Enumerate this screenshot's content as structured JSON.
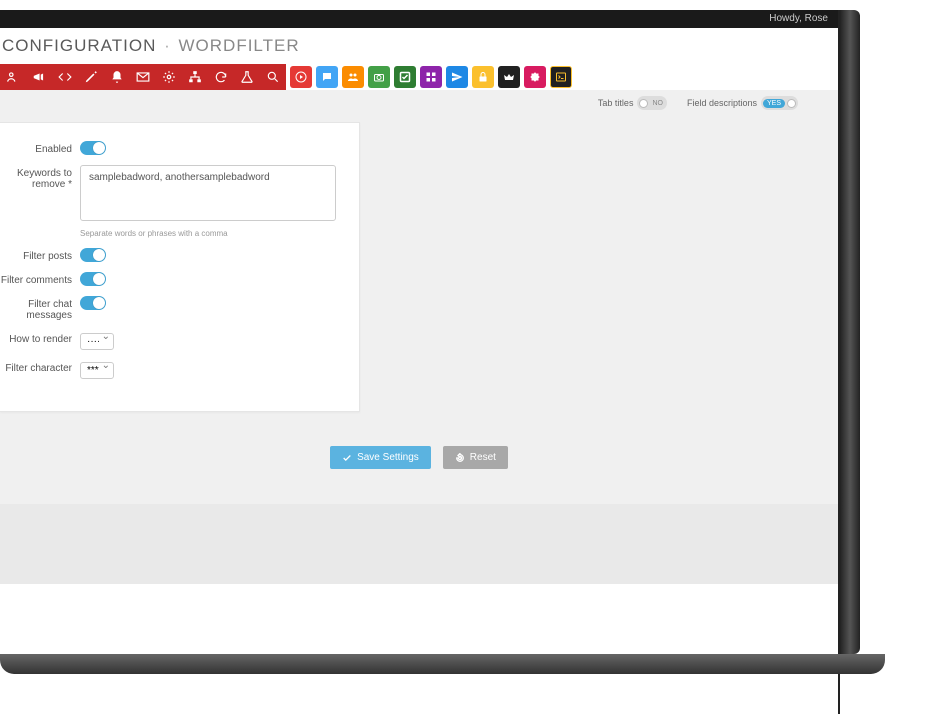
{
  "header": {
    "greeting": "Howdy, Rose",
    "title_main": "CONFIGURATION",
    "title_sub": "WORDFILTER"
  },
  "toolbar": {
    "red_icons": [
      "users",
      "megaphone",
      "code",
      "pencil",
      "bell",
      "mail",
      "gears",
      "sitemap",
      "refresh",
      "flask",
      "search"
    ],
    "color_icons": [
      {
        "name": "play",
        "bg": "#e53935"
      },
      {
        "name": "chat",
        "bg": "#42a5f5"
      },
      {
        "name": "crowd",
        "bg": "#fb8c00"
      },
      {
        "name": "camera",
        "bg": "#43a047"
      },
      {
        "name": "check",
        "bg": "#2e7d32"
      },
      {
        "name": "grid",
        "bg": "#8e24aa"
      },
      {
        "name": "send",
        "bg": "#1e88e5"
      },
      {
        "name": "lock",
        "bg": "#fbc02d"
      },
      {
        "name": "crown",
        "bg": "#212121"
      },
      {
        "name": "puzzle",
        "bg": "#d81b60"
      },
      {
        "name": "terminal",
        "bg": "#212121"
      }
    ]
  },
  "options": {
    "tab_titles_label": "Tab titles",
    "tab_titles_on": "NO",
    "field_desc_label": "Field descriptions",
    "field_desc_on": "YES"
  },
  "form": {
    "enabled_label": "Enabled",
    "keywords_label": "Keywords to remove *",
    "keywords_value": "samplebadword, anothersamplebadword",
    "keywords_hint": "Separate words or phrases with a comma",
    "filter_posts_label": "Filter posts",
    "filter_comments_label": "Filter comments",
    "filter_chat_label": "Filter chat messages",
    "how_to_render_label": "How to render",
    "how_to_render_value": "····",
    "filter_char_label": "Filter character",
    "filter_char_value": "****"
  },
  "actions": {
    "save": "Save Settings",
    "reset": "Reset"
  }
}
